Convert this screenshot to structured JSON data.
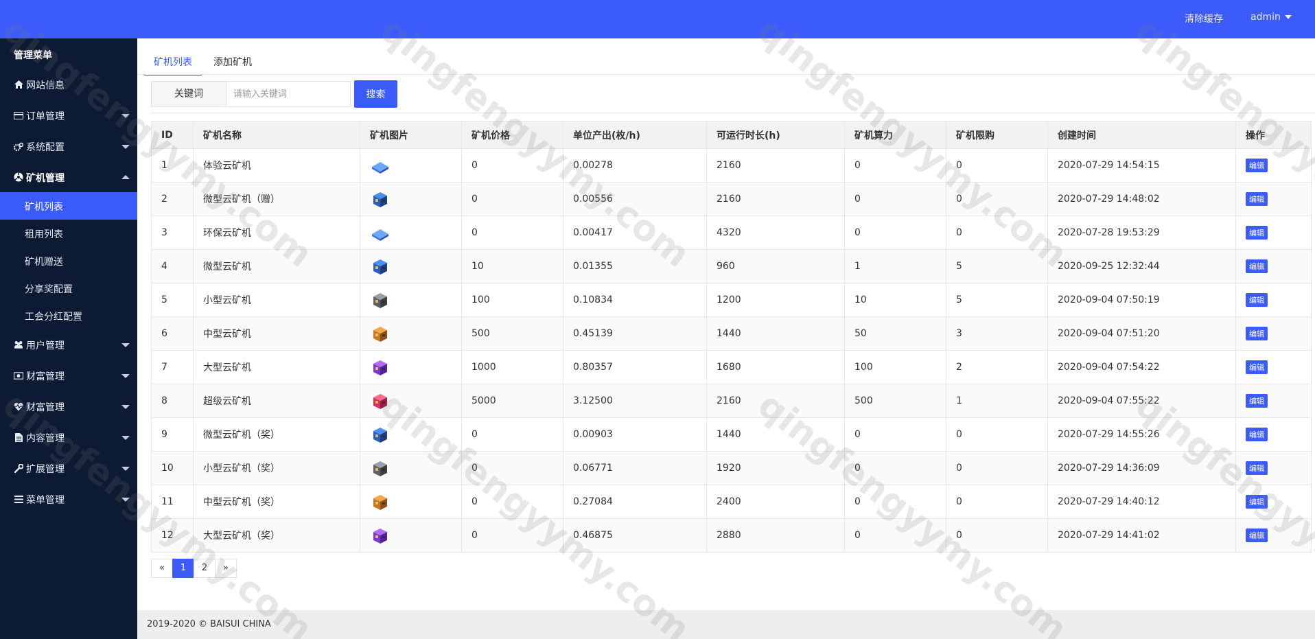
{
  "header": {
    "clear_cache": "清除缓存",
    "user": "admin"
  },
  "sidebar": {
    "title": "管理菜单",
    "items": [
      {
        "label": "网站信息",
        "icon": "home-icon"
      },
      {
        "label": "订单管理",
        "icon": "card-icon"
      },
      {
        "label": "系统配置",
        "icon": "cogs-icon"
      },
      {
        "label": "矿机管理",
        "icon": "mining-icon"
      },
      {
        "label": "用户管理",
        "icon": "users-icon"
      },
      {
        "label": "财富管理",
        "icon": "money-icon"
      },
      {
        "label": "财富管理",
        "icon": "heartbeat-icon"
      },
      {
        "label": "内容管理",
        "icon": "file-icon"
      },
      {
        "label": "扩展管理",
        "icon": "wrench-icon"
      },
      {
        "label": "菜单管理",
        "icon": "bars-icon"
      }
    ],
    "subitems": [
      {
        "label": "矿机列表",
        "active": true
      },
      {
        "label": "租用列表"
      },
      {
        "label": "矿机赠送"
      },
      {
        "label": "分享奖配置"
      },
      {
        "label": "工会分红配置"
      }
    ]
  },
  "tabs": {
    "list": "矿机列表",
    "add": "添加矿机"
  },
  "search": {
    "label": "关键词",
    "placeholder": "请输入关键词",
    "button": "搜索"
  },
  "table": {
    "columns": [
      "ID",
      "矿机名称",
      "矿机图片",
      "矿机价格",
      "单位产出(枚/h)",
      "可运行时长(h)",
      "矿机算力",
      "矿机限购",
      "创建时间",
      "操作"
    ],
    "edit_label": "编辑",
    "rows": [
      {
        "id": "1",
        "name": "体验云矿机",
        "img": "flat-blue",
        "price": "0",
        "output": "0.00278",
        "hours": "2160",
        "power": "0",
        "limit": "0",
        "created": "2020-07-29 14:54:15"
      },
      {
        "id": "2",
        "name": "微型云矿机（赠）",
        "img": "blue",
        "price": "0",
        "output": "0.00556",
        "hours": "2160",
        "power": "0",
        "limit": "0",
        "created": "2020-07-29 14:48:02"
      },
      {
        "id": "3",
        "name": "环保云矿机",
        "img": "flat-blue",
        "price": "0",
        "output": "0.00417",
        "hours": "4320",
        "power": "0",
        "limit": "0",
        "created": "2020-07-28 19:53:29"
      },
      {
        "id": "4",
        "name": "微型云矿机",
        "img": "blue",
        "price": "10",
        "output": "0.01355",
        "hours": "960",
        "power": "1",
        "limit": "5",
        "created": "2020-09-25 12:32:44"
      },
      {
        "id": "5",
        "name": "小型云矿机",
        "img": "gray",
        "price": "100",
        "output": "0.10834",
        "hours": "1200",
        "power": "10",
        "limit": "5",
        "created": "2020-09-04 07:50:19"
      },
      {
        "id": "6",
        "name": "中型云矿机",
        "img": "orange",
        "price": "500",
        "output": "0.45139",
        "hours": "1440",
        "power": "50",
        "limit": "3",
        "created": "2020-09-04 07:51:20"
      },
      {
        "id": "7",
        "name": "大型云矿机",
        "img": "purple",
        "price": "1000",
        "output": "0.80357",
        "hours": "1680",
        "power": "100",
        "limit": "2",
        "created": "2020-09-04 07:54:22"
      },
      {
        "id": "8",
        "name": "超级云矿机",
        "img": "pink",
        "price": "5000",
        "output": "3.12500",
        "hours": "2160",
        "power": "500",
        "limit": "1",
        "created": "2020-09-04 07:55:22"
      },
      {
        "id": "9",
        "name": "微型云矿机（奖）",
        "img": "blue",
        "price": "0",
        "output": "0.00903",
        "hours": "1440",
        "power": "0",
        "limit": "0",
        "created": "2020-07-29 14:55:26"
      },
      {
        "id": "10",
        "name": "小型云矿机（奖）",
        "img": "gray",
        "price": "0",
        "output": "0.06771",
        "hours": "1920",
        "power": "0",
        "limit": "0",
        "created": "2020-07-29 14:36:09"
      },
      {
        "id": "11",
        "name": "中型云矿机（奖）",
        "img": "orange",
        "price": "0",
        "output": "0.27084",
        "hours": "2400",
        "power": "0",
        "limit": "0",
        "created": "2020-07-29 14:40:12"
      },
      {
        "id": "12",
        "name": "大型云矿机（奖）",
        "img": "purple",
        "price": "0",
        "output": "0.46875",
        "hours": "2880",
        "power": "0",
        "limit": "0",
        "created": "2020-07-29 14:41:02"
      }
    ]
  },
  "pagination": {
    "prev": "«",
    "pages": [
      "1",
      "2"
    ],
    "current": "1",
    "next": "»"
  },
  "footer": {
    "text": "2019-2020 © BAISUI CHINA"
  },
  "watermark": {
    "text": "qingfengyymy.com"
  },
  "colors": {
    "primary": "#3b5cfb",
    "sidebar": "#0d1a33"
  }
}
